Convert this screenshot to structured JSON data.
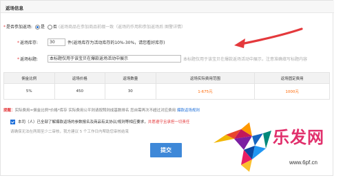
{
  "section": {
    "title": "返场信息"
  },
  "form": {
    "join_label": "是否参加返场:",
    "join_options": [
      {
        "label": "是",
        "selected": true
      },
      {
        "label": "否",
        "selected": false
      }
    ],
    "join_hint": "(返场商品在参加商品前缀一致（返场的作用和参加返场后 图警详情）",
    "stock_label": "返场库存:",
    "stock_value": "30",
    "stock_hint": "件(返场库存为活动库存的10%-30%，请您看好库存)",
    "title_label": "返场标题:",
    "title_value": "本标题仅用于该宝贝在爆款返场活动中展示",
    "title_hint": "本标题仅用于该宝贝在爆款返场活动中展示，注意准确填写标题内容"
  },
  "table": {
    "headers": [
      "佣金比例",
      "返场价格",
      "返场数量",
      "返场实际费用范围",
      "返场固定费用"
    ],
    "row": [
      "5%",
      "450",
      "30",
      "1-675元",
      "1000元"
    ]
  },
  "note": {
    "prefix": "提醒：",
    "text": "实际费用=佣金比例*价格*库存 实际费用公平则请按照则成基数排名 您自需再次不超过对应费用 ",
    "link": "爆款返场规则"
  },
  "agreement": {
    "text_a": "本司（人）已全部了解爆款返场的参数报名及商品有关协议/规则等相应要求，",
    "text_b": "并愿遵守且承担一切责任",
    "checked": true
  },
  "hint": "请确保无法在两周至少二审核，我方建议 5 个工作日内帮助您审核结束",
  "submit_label": "提交",
  "watermark": {
    "text": "乐发网",
    "url": "www.6pf.cn"
  },
  "colors": {
    "accent": "#1e6fd9",
    "button": "#3e88d8",
    "arrow": "#e4393c",
    "cost": "#ff6600"
  }
}
